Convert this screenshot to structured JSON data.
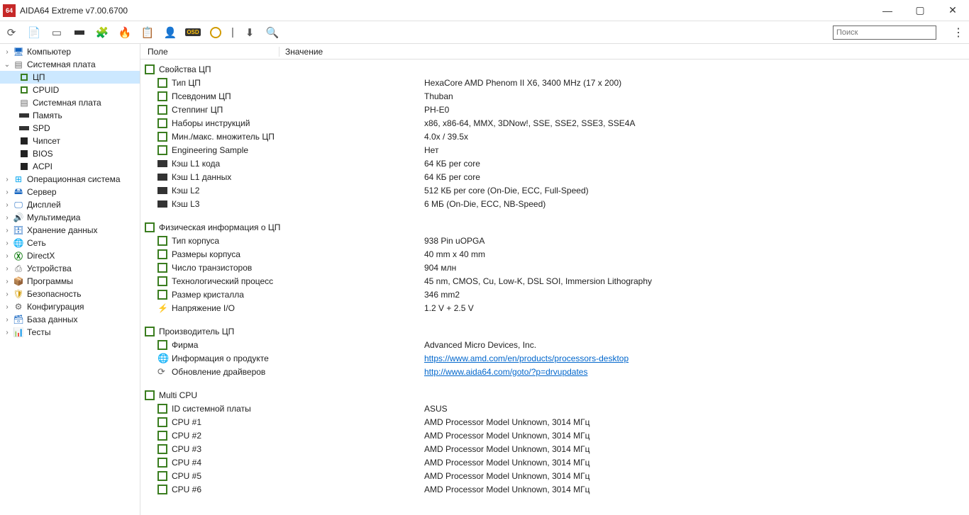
{
  "title": "AIDA64 Extreme v7.00.6700",
  "search_placeholder": "Поиск",
  "columns": {
    "field": "Поле",
    "value": "Значение"
  },
  "sidebar": {
    "items": [
      {
        "label": "Компьютер",
        "expanded": false,
        "level": 1,
        "icon": "monitor"
      },
      {
        "label": "Системная плата",
        "expanded": true,
        "level": 1,
        "icon": "board",
        "children": [
          {
            "label": "ЦП",
            "icon": "cpu",
            "selected": true
          },
          {
            "label": "CPUID",
            "icon": "cpu"
          },
          {
            "label": "Системная плата",
            "icon": "board"
          },
          {
            "label": "Память",
            "icon": "mem"
          },
          {
            "label": "SPD",
            "icon": "mem"
          },
          {
            "label": "Чипсет",
            "icon": "chip"
          },
          {
            "label": "BIOS",
            "icon": "chip"
          },
          {
            "label": "ACPI",
            "icon": "chip"
          }
        ]
      },
      {
        "label": "Операционная система",
        "expanded": false,
        "level": 1,
        "icon": "win"
      },
      {
        "label": "Сервер",
        "expanded": false,
        "level": 1,
        "icon": "server"
      },
      {
        "label": "Дисплей",
        "expanded": false,
        "level": 1,
        "icon": "disp"
      },
      {
        "label": "Мультимедиа",
        "expanded": false,
        "level": 1,
        "icon": "audio"
      },
      {
        "label": "Хранение данных",
        "expanded": false,
        "level": 1,
        "icon": "hdd"
      },
      {
        "label": "Сеть",
        "expanded": false,
        "level": 1,
        "icon": "net"
      },
      {
        "label": "DirectX",
        "expanded": false,
        "level": 1,
        "icon": "dx"
      },
      {
        "label": "Устройства",
        "expanded": false,
        "level": 1,
        "icon": "dev"
      },
      {
        "label": "Программы",
        "expanded": false,
        "level": 1,
        "icon": "prog"
      },
      {
        "label": "Безопасность",
        "expanded": false,
        "level": 1,
        "icon": "sec"
      },
      {
        "label": "Конфигурация",
        "expanded": false,
        "level": 1,
        "icon": "conf"
      },
      {
        "label": "База данных",
        "expanded": false,
        "level": 1,
        "icon": "db"
      },
      {
        "label": "Тесты",
        "expanded": false,
        "level": 1,
        "icon": "test"
      }
    ]
  },
  "sections": [
    {
      "title": "Свойства ЦП",
      "icon": "cpu",
      "rows": [
        {
          "field": "Тип ЦП",
          "value": "HexaCore AMD Phenom II X6, 3400 MHz (17 x 200)",
          "icon": "cpu"
        },
        {
          "field": "Псевдоним ЦП",
          "value": "Thuban",
          "icon": "cpu"
        },
        {
          "field": "Степпинг ЦП",
          "value": "PH-E0",
          "icon": "cpu"
        },
        {
          "field": "Наборы инструкций",
          "value": "x86, x86-64, MMX, 3DNow!, SSE, SSE2, SSE3, SSE4A",
          "icon": "cpu"
        },
        {
          "field": "Мин./макс. множитель ЦП",
          "value": "4.0x / 39.5x",
          "icon": "cpu"
        },
        {
          "field": "Engineering Sample",
          "value": "Нет",
          "icon": "cpu"
        },
        {
          "field": "Кэш L1 кода",
          "value": "64 КБ per core",
          "icon": "chip"
        },
        {
          "field": "Кэш L1 данных",
          "value": "64 КБ per core",
          "icon": "chip"
        },
        {
          "field": "Кэш L2",
          "value": "512 КБ per core  (On-Die, ECC, Full-Speed)",
          "icon": "chip"
        },
        {
          "field": "Кэш L3",
          "value": "6 МБ  (On-Die, ECC, NB-Speed)",
          "icon": "chip"
        }
      ]
    },
    {
      "title": "Физическая информация о ЦП",
      "icon": "cpu",
      "rows": [
        {
          "field": "Тип корпуса",
          "value": "938 Pin uOPGA",
          "icon": "cpu"
        },
        {
          "field": "Размеры корпуса",
          "value": "40 mm x 40 mm",
          "icon": "cpu"
        },
        {
          "field": "Число транзисторов",
          "value": "904 млн",
          "icon": "cpu"
        },
        {
          "field": "Технологический процесс",
          "value": "45 nm, CMOS, Cu, Low-K, DSL SOI, Immersion Lithography",
          "icon": "cpu"
        },
        {
          "field": "Размер кристалла",
          "value": "346 mm2",
          "icon": "cpu"
        },
        {
          "field": "Напряжение I/O",
          "value": "1.2 V + 2.5 V",
          "icon": "volt"
        }
      ]
    },
    {
      "title": "Производитель ЦП",
      "icon": "cpu",
      "rows": [
        {
          "field": "Фирма",
          "value": "Advanced Micro Devices, Inc.",
          "icon": "cpu"
        },
        {
          "field": "Информация о продукте",
          "value": "https://www.amd.com/en/products/processors-desktop",
          "icon": "globe",
          "link": true
        },
        {
          "field": "Обновление драйверов",
          "value": "http://www.aida64.com/goto/?p=drvupdates",
          "icon": "drv",
          "link": true
        }
      ]
    },
    {
      "title": "Multi CPU",
      "icon": "cpu",
      "rows": [
        {
          "field": "ID системной платы",
          "value": "ASUS",
          "icon": "cpu"
        },
        {
          "field": "CPU #1",
          "value": "AMD Processor Model Unknown, 3014 МГц",
          "icon": "cpu"
        },
        {
          "field": "CPU #2",
          "value": "AMD Processor Model Unknown, 3014 МГц",
          "icon": "cpu"
        },
        {
          "field": "CPU #3",
          "value": "AMD Processor Model Unknown, 3014 МГц",
          "icon": "cpu"
        },
        {
          "field": "CPU #4",
          "value": "AMD Processor Model Unknown, 3014 МГц",
          "icon": "cpu"
        },
        {
          "field": "CPU #5",
          "value": "AMD Processor Model Unknown, 3014 МГц",
          "icon": "cpu"
        },
        {
          "field": "CPU #6",
          "value": "AMD Processor Model Unknown, 3014 МГц",
          "icon": "cpu"
        }
      ]
    }
  ]
}
